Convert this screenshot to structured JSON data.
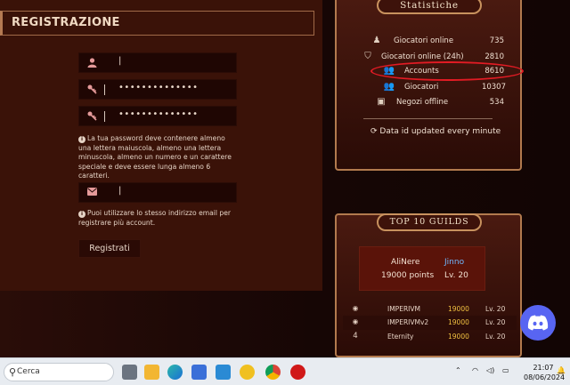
{
  "registration": {
    "title": "REGISTRAZIONE",
    "username_value": "|",
    "password_value": "••••••••••••••",
    "confirm_value": "••••••••••••••",
    "password_note": "La tua password deve contenere almeno una lettera maiuscola, almeno una lettera minuscola, almeno un numero e un carattere speciale e deve essere lunga almeno 6 caratteri.",
    "email_value": "|",
    "email_note": "Puoi utilizzare lo stesso indirizzo email per registrare più account.",
    "submit_label": "Registrati"
  },
  "stats": {
    "title": "Statistiche",
    "rows": [
      {
        "label": "Giocatori online",
        "value": "735",
        "icon": "player-icon"
      },
      {
        "label": "Giocatori online (24h)",
        "value": "2810",
        "icon": "shield-icon"
      },
      {
        "label": "Accounts",
        "value": "8610",
        "icon": "users-icon"
      },
      {
        "label": "Giocatori",
        "value": "10307",
        "icon": "user-group-icon"
      },
      {
        "label": "Negozi offline",
        "value": "534",
        "icon": "shop-icon"
      }
    ],
    "updated_text": "Data id updated every minute"
  },
  "guilds": {
    "title": "Top 10 Guilds",
    "top": {
      "name": "AliNere",
      "leader": "Jinno",
      "points": "19000 points",
      "level": "Lv. 20"
    },
    "rows": [
      {
        "rank": "",
        "name": "IMPERIVM",
        "points": "19000",
        "level": "Lv. 20"
      },
      {
        "rank": "",
        "name": "IMPERIVMv2",
        "points": "19000",
        "level": "Lv. 20"
      },
      {
        "rank": "4",
        "name": "Eternity",
        "points": "19000",
        "level": "Lv. 20"
      }
    ]
  },
  "taskbar": {
    "search_placeholder": "Cerca",
    "time": "21:07",
    "date": "08/06/2024"
  },
  "colors": {
    "highlight": "#e21b24",
    "discord": "#5865f2",
    "gold": "#f0c040"
  }
}
